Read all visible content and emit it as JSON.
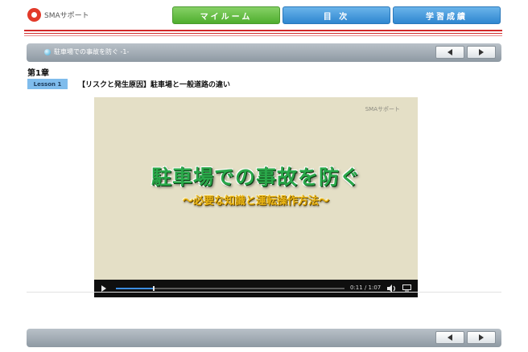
{
  "header": {
    "logo_text": "SMAサポート",
    "nav": {
      "mypage": "マイルーム",
      "toc": "目 次",
      "results": "学習成績"
    }
  },
  "title_bar": {
    "title": "駐車場での事故を防ぐ -1-"
  },
  "chapter": {
    "label": "第1章"
  },
  "lesson": {
    "badge": "Lesson 1",
    "title": "【リスクと発生原因】駐車場と一般道路の違い"
  },
  "video": {
    "watermark": "SMAサポート",
    "heading": "駐車場での事故を防ぐ",
    "subheading": "～必要な知識と運転操作方法～",
    "current_time": "0:11",
    "duration": "1:07",
    "time_display": "0:11 / 1:07",
    "played_fraction": 0.164
  },
  "colors": {
    "nav_green": "#4fae2e",
    "nav_blue": "#2e86d0",
    "rule_red": "#d22a2a",
    "video_background": "#e4dfc6",
    "heading_green": "#2aa84a",
    "subheading_gold": "#e9b414"
  },
  "icons": {
    "logo": "sma-circle-logo",
    "title_bullet": "blue-dot-icon",
    "prev": "arrow-left-icon",
    "next": "arrow-right-icon",
    "play": "play-icon",
    "volume": "volume-icon",
    "screen": "screen-icon"
  }
}
